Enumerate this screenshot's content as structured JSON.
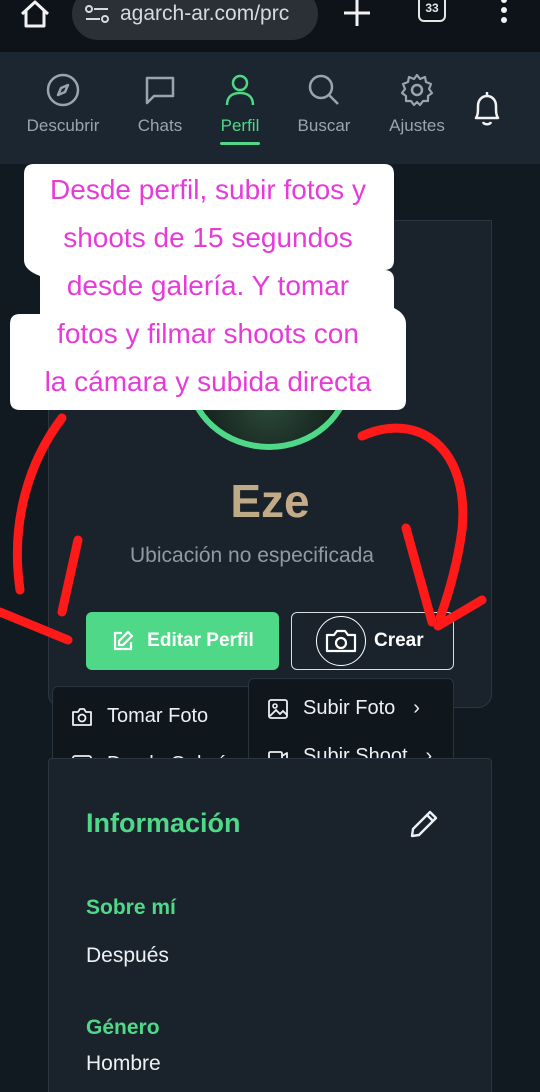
{
  "browser": {
    "url": "agarch-ar.com/prc",
    "tab_count": "33"
  },
  "nav": {
    "items": [
      {
        "label": "Descubrir",
        "icon": "compass-icon"
      },
      {
        "label": "Chats",
        "icon": "chat-icon"
      },
      {
        "label": "Perfil",
        "icon": "user-icon",
        "active": true
      },
      {
        "label": "Buscar",
        "icon": "search-icon"
      },
      {
        "label": "Ajustes",
        "icon": "gear-icon"
      }
    ],
    "notifications_icon": "bell-icon"
  },
  "profile": {
    "name": "Eze",
    "location": "Ubicación no especificada",
    "edit_label": "Editar Perfil",
    "create_label": "Crear"
  },
  "create_menu": {
    "left": [
      {
        "label": "Tomar Foto",
        "icon": "camera-icon"
      },
      {
        "label": "Desde Galería",
        "icon": "image-icon"
      }
    ],
    "right": [
      {
        "label": "Subir Foto",
        "icon": "image-icon"
      },
      {
        "label": "Subir Shoot",
        "icon": "video-icon"
      }
    ]
  },
  "info": {
    "title": "Información",
    "about_label": "Sobre mí",
    "about_value": "Después",
    "gender_label": "Género",
    "gender_value": "Hombre"
  },
  "annotation": {
    "lines": [
      "Desde perfil, subir fotos y",
      "shoots de 15 segundos",
      "desde galería. Y tomar",
      "fotos y filmar shoots con",
      "la cámara y subida directa"
    ]
  },
  "colors": {
    "accent": "#4fd888",
    "background": "#121a21",
    "annotation": "#e63ad9",
    "arrow": "#ff1a1a"
  }
}
